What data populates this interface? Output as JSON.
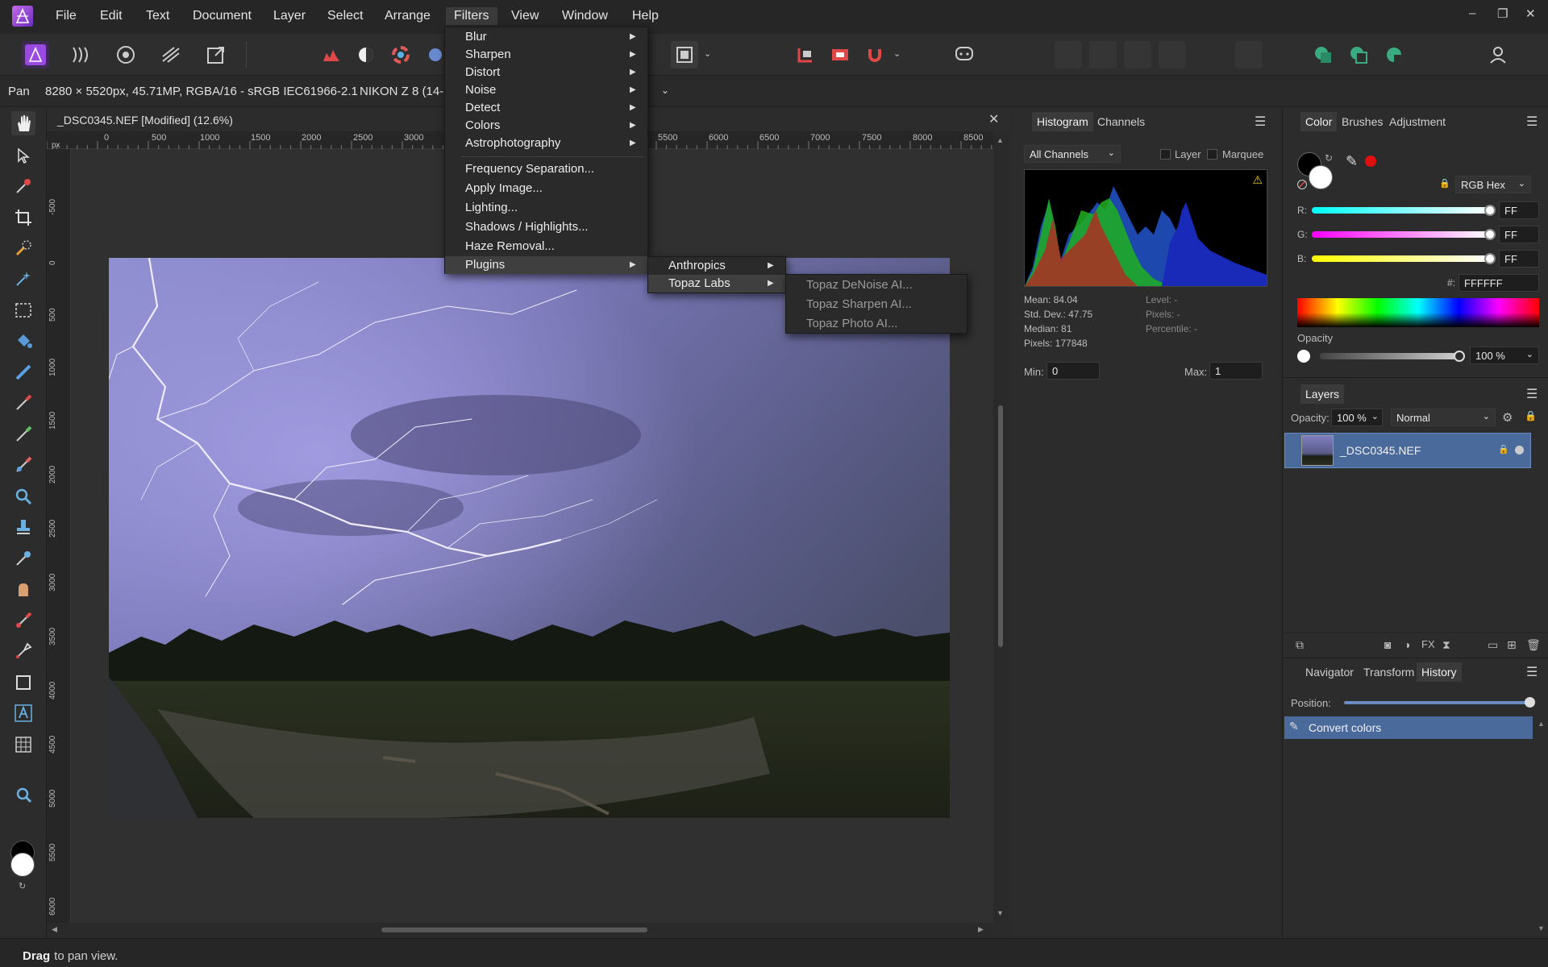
{
  "app": {
    "logo": "affinity-photo-logo"
  },
  "menubar": {
    "items": [
      "File",
      "Edit",
      "Text",
      "Document",
      "Layer",
      "Select",
      "Arrange",
      "Filters",
      "View",
      "Window",
      "Help"
    ],
    "active": "Filters",
    "window_controls": {
      "minimize": "–",
      "restore": "❐",
      "close": "✕"
    }
  },
  "context_bar": {
    "tool": "Pan",
    "image_info": "8280 × 5520px, 45.71MP, RGBA/16 - sRGB IEC61966-2.1",
    "camera": "NIKON Z 8 (14-2"
  },
  "document": {
    "title": "_DSC0345.NEF [Modified] (12.6%)",
    "close": "✕",
    "ruler_unit": "px",
    "h_ticks": [
      "0",
      "500",
      "1000",
      "1500",
      "2000",
      "2500",
      "3000",
      "5500",
      "6000",
      "6500",
      "7000",
      "7500",
      "8000",
      "8500"
    ],
    "v_ticks": [
      "0",
      "-500",
      "500",
      "1000",
      "1500",
      "2000",
      "2500",
      "3000",
      "3500",
      "4000",
      "4500",
      "5000",
      "5500",
      "6000",
      "500"
    ]
  },
  "filters_menu": {
    "items": [
      {
        "label": "Blur",
        "submenu": true
      },
      {
        "label": "Sharpen",
        "submenu": true
      },
      {
        "label": "Distort",
        "submenu": true
      },
      {
        "label": "Noise",
        "submenu": true
      },
      {
        "label": "Detect",
        "submenu": true
      },
      {
        "label": "Colors",
        "submenu": true
      },
      {
        "label": "Astrophotography",
        "submenu": true
      },
      {
        "label": "Frequency Separation...",
        "submenu": false
      },
      {
        "label": "Apply Image...",
        "submenu": false
      },
      {
        "label": "Lighting...",
        "submenu": false
      },
      {
        "label": "Shadows / Highlights...",
        "submenu": false
      },
      {
        "label": "Haze Removal...",
        "submenu": false
      },
      {
        "label": "Plugins",
        "submenu": true,
        "highlighted": true
      }
    ],
    "plugins_submenu": [
      "Anthropics",
      "Topaz Labs"
    ],
    "topaz_submenu": [
      "Topaz DeNoise AI...",
      "Topaz Sharpen AI...",
      "Topaz Photo AI..."
    ]
  },
  "histogram_panel": {
    "tabs": [
      "Histogram",
      "Channels"
    ],
    "channel_select": "All Channels",
    "check_layer": "Layer",
    "check_marquee": "Marquee",
    "stats_left": [
      "Mean: 84.04",
      "Std. Dev.: 47.75",
      "Median: 81",
      "Pixels: 177848"
    ],
    "stats_right": [
      "Level: -",
      "Pixels: -",
      "Percentile: -"
    ],
    "min_label": "Min:",
    "min_value": "0",
    "max_label": "Max:",
    "max_value": "1"
  },
  "color_panel": {
    "tabs": [
      "Color",
      "Brushes",
      "Adjustment"
    ],
    "model": "RGB Hex",
    "r_label": "R:",
    "r_value": "FF",
    "g_label": "G:",
    "g_value": "FF",
    "b_label": "B:",
    "b_value": "FF",
    "hex_label": "#:",
    "hex_value": "FFFFFF",
    "opacity_label": "Opacity",
    "opacity_value": "100 %"
  },
  "layers_panel": {
    "title": "Layers",
    "opacity_label": "Opacity:",
    "opacity_value": "100 %",
    "blend_mode": "Normal",
    "layer_name": "_DSC0345.NEF"
  },
  "history_panel": {
    "tabs": [
      "Navigator",
      "Transform",
      "History"
    ],
    "position_label": "Position:",
    "entry": "Convert colors"
  },
  "status": {
    "bold": "Drag",
    "text": " to pan view."
  },
  "colors": {
    "accent": "#4a6a9c",
    "menu_bg": "#2a2a2a",
    "panel_bg": "#2c2c2c",
    "brand": "#8a3ad6"
  }
}
